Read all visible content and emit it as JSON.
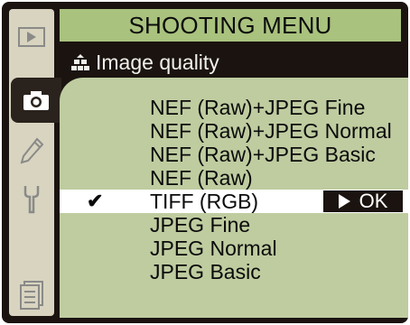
{
  "header": {
    "title": "SHOOTING MENU"
  },
  "submenu": {
    "icon": "image-quality-icon",
    "title": "Image quality"
  },
  "sidebar": {
    "items": [
      {
        "icon": "playback-icon",
        "active": false
      },
      {
        "icon": "camera-icon",
        "active": true
      },
      {
        "icon": "pencil-icon",
        "active": false
      },
      {
        "icon": "wrench-icon",
        "active": false
      },
      {
        "icon": "recent-settings-icon",
        "active": false
      }
    ]
  },
  "options": [
    {
      "label": "NEF (Raw)+JPEG Fine"
    },
    {
      "label": "NEF (Raw)+JPEG Normal"
    },
    {
      "label": "NEF (Raw)+JPEG Basic"
    },
    {
      "label": "NEF (Raw)"
    },
    {
      "label": "TIFF (RGB)",
      "selected": true,
      "check": "✔"
    },
    {
      "label": "JPEG Fine"
    },
    {
      "label": "JPEG Normal"
    },
    {
      "label": "JPEG Basic"
    }
  ],
  "ok_button": {
    "label": "OK"
  },
  "colors": {
    "header": "#a9c27e",
    "panel": "#bfcca0",
    "background": "#1a1310"
  }
}
